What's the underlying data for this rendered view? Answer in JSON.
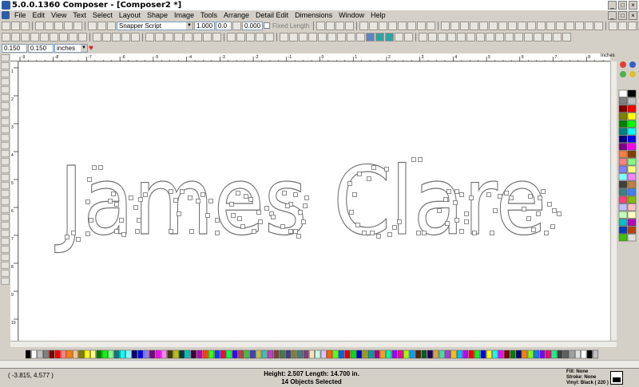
{
  "window": {
    "title": "5.0.0.1360 Composer - [Composer2 *]",
    "buttons": [
      "_",
      "□",
      "×"
    ]
  },
  "menu": [
    "File",
    "Edit",
    "View",
    "Text",
    "Select",
    "Layout",
    "Shape",
    "Image",
    "Tools",
    "Arrange",
    "Detail Edit",
    "Dimensions",
    "Window",
    "Help"
  ],
  "toolbar": {
    "font_name": "Snapper Script",
    "font_size": "1.000",
    "spacing": "0.0",
    "spacing2": "0.000",
    "fixed_length_label": "Fixed Length",
    "pos_x": "0.150",
    "pos_y": "0.150",
    "units": "inches"
  },
  "ruler": {
    "units_label": "Inches",
    "top_ticks": [
      "-9",
      "-8",
      "-7",
      "-6",
      "-5",
      "-4",
      "-3",
      "-2",
      "-1",
      "0",
      "1",
      "2",
      "3",
      "4",
      "5",
      "6",
      "7",
      "8"
    ],
    "left_ticks": [
      "1",
      "2",
      "3",
      "4",
      "5",
      "6",
      "7",
      "8",
      "9",
      "10"
    ]
  },
  "canvas": {
    "text": "James Clare",
    "outline_color": "#707070",
    "node_color": "#707070"
  },
  "palette": {
    "vertical": [
      "#ffffff",
      "#000000",
      "#7f7f7f",
      "#c0c0c0",
      "#800000",
      "#ff0000",
      "#808000",
      "#ffff00",
      "#008000",
      "#00ff00",
      "#008080",
      "#00ffff",
      "#000080",
      "#0000ff",
      "#800080",
      "#ff00ff",
      "#ff8040",
      "#804000",
      "#ff8080",
      "#80ff80",
      "#8080ff",
      "#ffff80",
      "#80ffff",
      "#ff80ff",
      "#404040",
      "#c08040",
      "#408080",
      "#4080ff",
      "#ff4080",
      "#80c000",
      "#c0c0ff",
      "#ffc0c0",
      "#c0ffc0",
      "#ffffc0",
      "#00c0c0",
      "#c000c0",
      "#0040c0",
      "#c04000",
      "#40c000",
      "#e0e0e0"
    ],
    "horizontal": [
      "#000000",
      "#ffffff",
      "#c0c0c0",
      "#808080",
      "#800000",
      "#ff0000",
      "#ff8080",
      "#ff8000",
      "#ffc080",
      "#808000",
      "#ffff00",
      "#ffff80",
      "#008000",
      "#00ff00",
      "#80ff80",
      "#008080",
      "#00ffff",
      "#80ffff",
      "#000080",
      "#0000ff",
      "#8080ff",
      "#800080",
      "#ff00ff",
      "#ff80ff",
      "#404000",
      "#c0c000",
      "#004040",
      "#00c0c0",
      "#400040",
      "#c000c0",
      "#ff4000",
      "#40ff00",
      "#0040ff",
      "#ff0040",
      "#00ff40",
      "#4000ff",
      "#c04040",
      "#40c040",
      "#4040c0",
      "#c0c040",
      "#40c0c0",
      "#c040c0",
      "#804040",
      "#408040",
      "#404080",
      "#808040",
      "#408080",
      "#804080",
      "#ffe0c0",
      "#c0ffe0",
      "#e0c0ff",
      "#ff6000",
      "#60ff00",
      "#0060ff",
      "#e00000",
      "#00e000",
      "#0000e0",
      "#a0a000",
      "#00a0a0",
      "#a000a0",
      "#ffa000",
      "#00ffa0",
      "#a000ff",
      "#ff00a0",
      "#a0ff00",
      "#00a0ff",
      "#602000",
      "#006020",
      "#200060",
      "#e0a040",
      "#40e0a0",
      "#a040e0",
      "#ffc000",
      "#00c0ff",
      "#c000ff",
      "#ff0000",
      "#00ff00",
      "#0000ff",
      "#ffff00",
      "#00ffff",
      "#ff00ff",
      "#800000",
      "#008000",
      "#000080",
      "#ff8000",
      "#80ff00",
      "#0080ff",
      "#8000ff",
      "#ff0080",
      "#00ff80",
      "#404040",
      "#606060",
      "#a0a0a0",
      "#e0e0e0",
      "#ffffff",
      "#000000",
      "#c0c0c0"
    ]
  },
  "status": {
    "coords": "( -3.815, 4.577 )",
    "height_label": "Height: 2.507   Length: 14.700  in.",
    "selection": "14 Objects Selected",
    "fill": "Fill: None",
    "stroke": "Stroke: None",
    "vinyl": "Vinyl: Black ( 220 )"
  }
}
